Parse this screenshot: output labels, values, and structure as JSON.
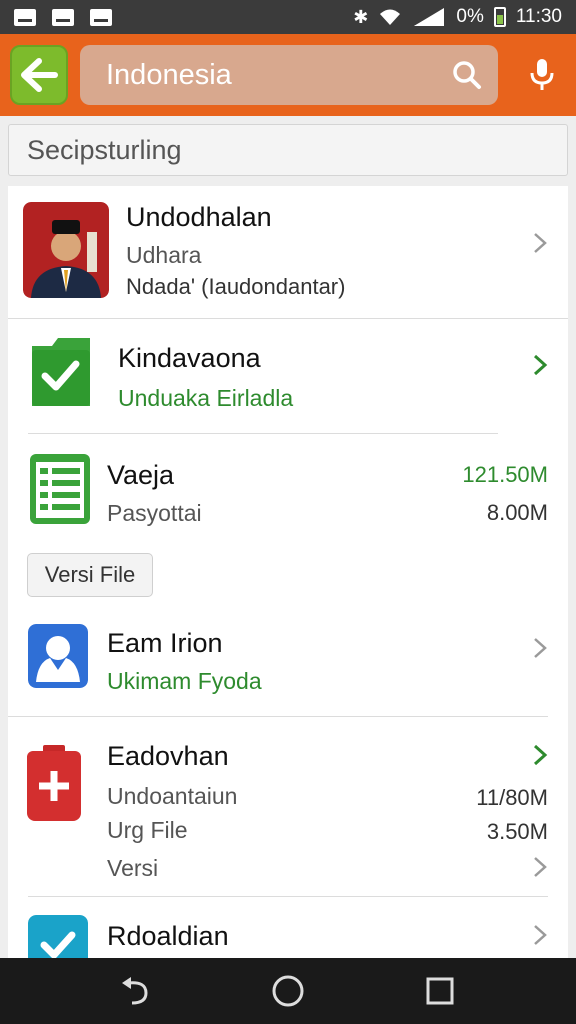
{
  "status_bar": {
    "signal_text": "0%",
    "time": "11:30",
    "icons": [
      "image-icon",
      "mail-icon",
      "notification-icon",
      "bluetooth-icon",
      "wifi-icon",
      "signal-icon",
      "battery-icon"
    ]
  },
  "toolbar": {
    "search_value": "Indonesia",
    "icons": [
      "back-arrow-icon",
      "search-icon",
      "mic-icon"
    ],
    "colors": {
      "bar": "#e8631c",
      "back_button": "#7dbb2c"
    }
  },
  "section_header": {
    "label": "Secipsturling"
  },
  "items": [
    {
      "title": "Undodhalan",
      "subtitle": "Udhara",
      "detail": "Ndada' (Iaudondantar)",
      "icon": "portrait-icon"
    },
    {
      "title": "Kindavaona",
      "subtitle": "Unduaka Eirladla",
      "icon": "green-folder-check-icon"
    },
    {
      "title": "Vaeja",
      "subtitle": "Pasyottai",
      "value_primary": "121.50M",
      "value_secondary": "8.00M",
      "icon": "spreadsheet-icon"
    },
    {
      "title": "Eam Irion",
      "subtitle": "Ukimam Fyoda",
      "icon": "blue-person-icon"
    },
    {
      "title": "Eadovhan",
      "subtitle": "Undoantaiun",
      "value_primary": "11/80M",
      "subtitle2": "Urg File",
      "value_secondary": "3.50M",
      "subtitle3": "Versi",
      "icon": "red-plus-icon"
    },
    {
      "title": "Rdoaldian",
      "icon": "blue-check-icon"
    }
  ],
  "version_button": {
    "label": "Versi File"
  },
  "nav_bar": {
    "icons": [
      "back-nav-icon",
      "home-nav-icon",
      "recents-nav-icon"
    ]
  }
}
